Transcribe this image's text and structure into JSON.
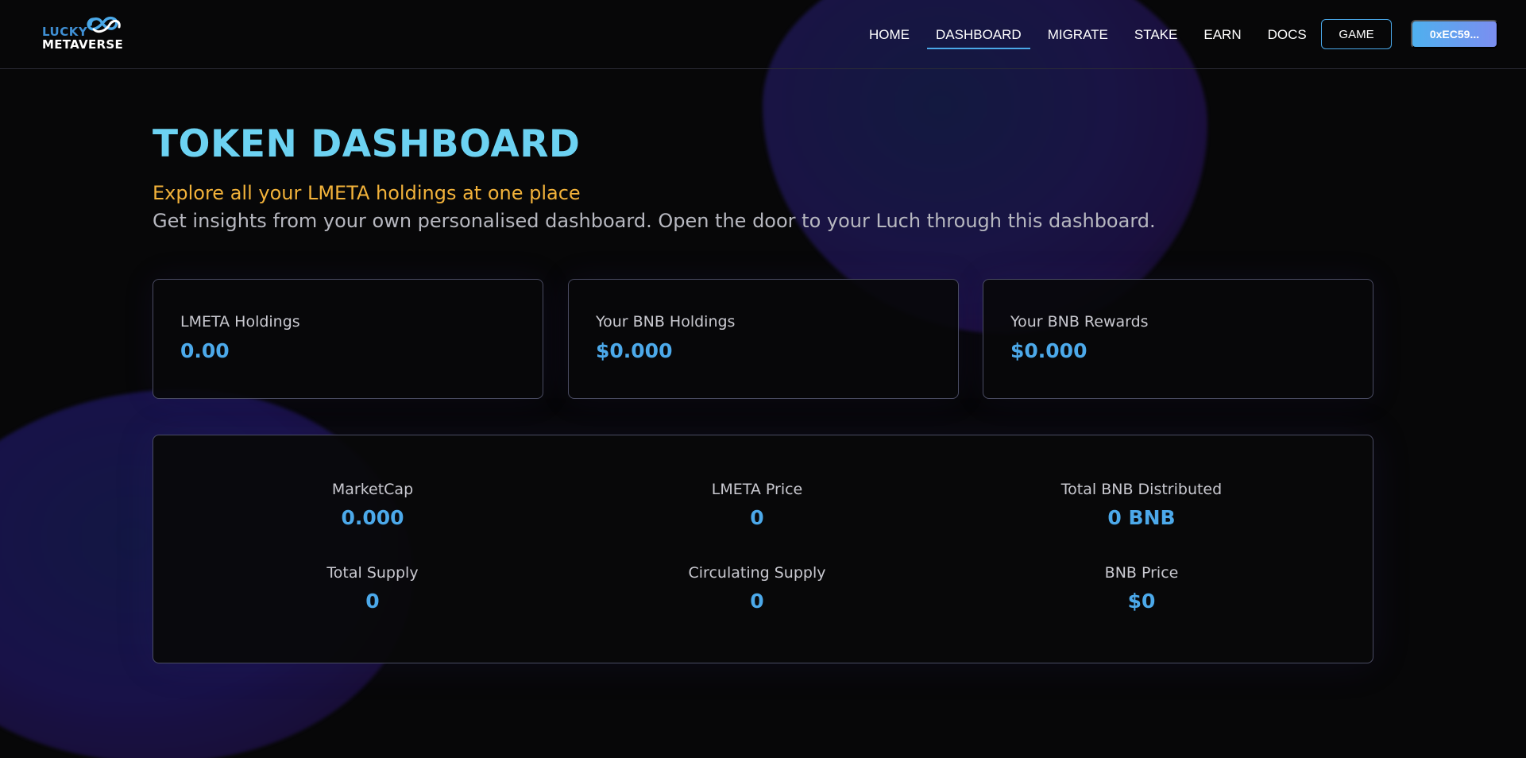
{
  "brand": {
    "line1": "LUCKY",
    "line2": "METAVERSE",
    "icon": "infinity-logo-icon"
  },
  "nav": {
    "items": [
      {
        "label": "HOME",
        "active": false
      },
      {
        "label": "DASHBOARD",
        "active": true
      },
      {
        "label": "MIGRATE",
        "active": false
      },
      {
        "label": "STAKE",
        "active": false
      },
      {
        "label": "EARN",
        "active": false
      },
      {
        "label": "DOCS",
        "active": false
      }
    ],
    "game_label": "GAME",
    "wallet_label": "0xEC59..."
  },
  "hero": {
    "title": "TOKEN DASHBOARD",
    "subtitle": "Explore all your LMETA holdings at one place",
    "description": "Get insights from your own personalised dashboard. Open the door to your Luch through this dashboard."
  },
  "cards": [
    {
      "label": "LMETA Holdings",
      "value": "0.00"
    },
    {
      "label": "Your BNB Holdings",
      "value": "$0.000"
    },
    {
      "label": "Your BNB Rewards",
      "value": "$0.000"
    }
  ],
  "stats": [
    {
      "label": "MarketCap",
      "value": "0.000"
    },
    {
      "label": "LMETA Price",
      "value": "0"
    },
    {
      "label": "Total BNB Distributed",
      "value": "0 BNB"
    },
    {
      "label": "Total Supply",
      "value": "0"
    },
    {
      "label": "Circulating Supply",
      "value": "0"
    },
    {
      "label": "BNB Price",
      "value": "$0"
    }
  ],
  "colors": {
    "background": "#070708",
    "accent_blue": "#4ca9ea",
    "title_cyan": "#6cd2f2",
    "subtitle_orange": "#f2b23a",
    "border": "#4a4c63"
  }
}
